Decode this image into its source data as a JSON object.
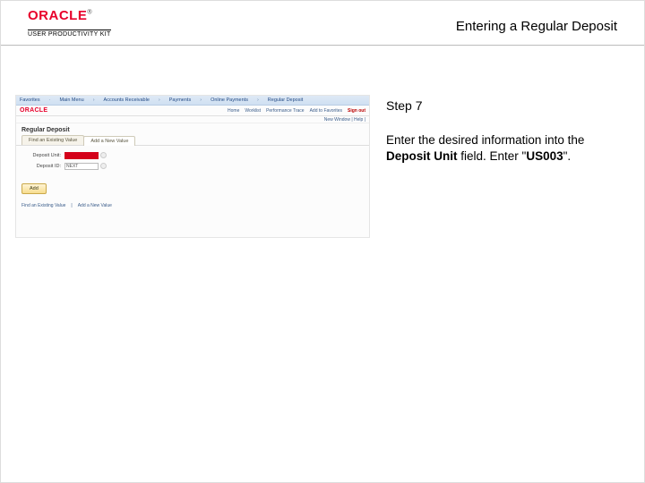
{
  "header": {
    "brand": "ORACLE",
    "tm": "®",
    "sub": "USER PRODUCTIVITY KIT",
    "topic_title": "Entering a Regular Deposit"
  },
  "screenshot": {
    "crumbs": [
      "Favorites",
      "Main Menu",
      "Accounts Receivable",
      "Payments",
      "Online Payments",
      "Regular Deposit"
    ],
    "brand": "ORACLE",
    "nav": {
      "home": "Home",
      "worklist": "Worklist",
      "pm": "Performance Trace",
      "add": "Add to Favorites",
      "signout": "Sign out"
    },
    "newwin": "New Window | Help | ",
    "section_title": "Regular Deposit",
    "tabs": {
      "t1": "Find an Existing Value",
      "t2": "Add a New Value"
    },
    "form": {
      "unit_label": "Deposit Unit:",
      "unit_value": "",
      "id_label": "Deposit ID:",
      "id_value": "NEXT"
    },
    "add_btn": "Add",
    "footlinks": {
      "a": "Find an Existing Value",
      "b": "Add a New Value"
    }
  },
  "instructions": {
    "step": "Step 7",
    "text_prefix": "Enter the desired information into the ",
    "field_name": "Deposit Unit",
    "text_mid": " field. Enter \"",
    "value": "US003",
    "text_suffix": "\"."
  }
}
